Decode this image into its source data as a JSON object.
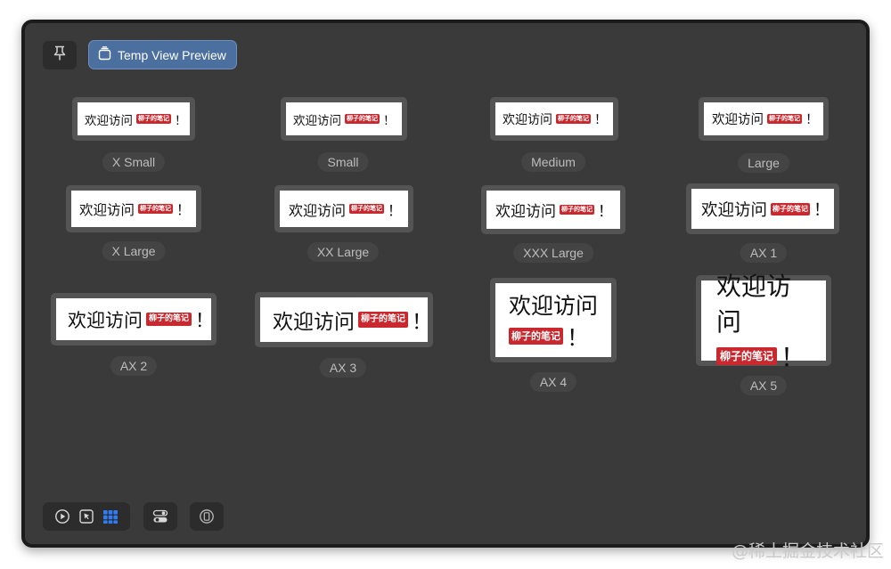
{
  "toolbar": {
    "preview_tab_label": "Temp View Preview"
  },
  "card": {
    "greeting": "欢迎访问",
    "badge": "柳子的笔记",
    "exclaim": "！"
  },
  "previews": [
    {
      "label": "X Small"
    },
    {
      "label": "Small"
    },
    {
      "label": "Medium"
    },
    {
      "label": "Large"
    },
    {
      "label": "X Large"
    },
    {
      "label": "XX Large"
    },
    {
      "label": "XXX Large"
    },
    {
      "label": "AX 1"
    },
    {
      "label": "AX 2"
    },
    {
      "label": "AX 3"
    },
    {
      "label": "AX 4"
    },
    {
      "label": "AX 5"
    }
  ],
  "bottom_toolbar": {
    "icons": [
      "play-icon",
      "cursor-select-icon",
      "grid-icon",
      "toggles-icon",
      "device-icon"
    ],
    "active_color": "#2f7cf6"
  },
  "watermark": "@稀土掘金技术社区"
}
